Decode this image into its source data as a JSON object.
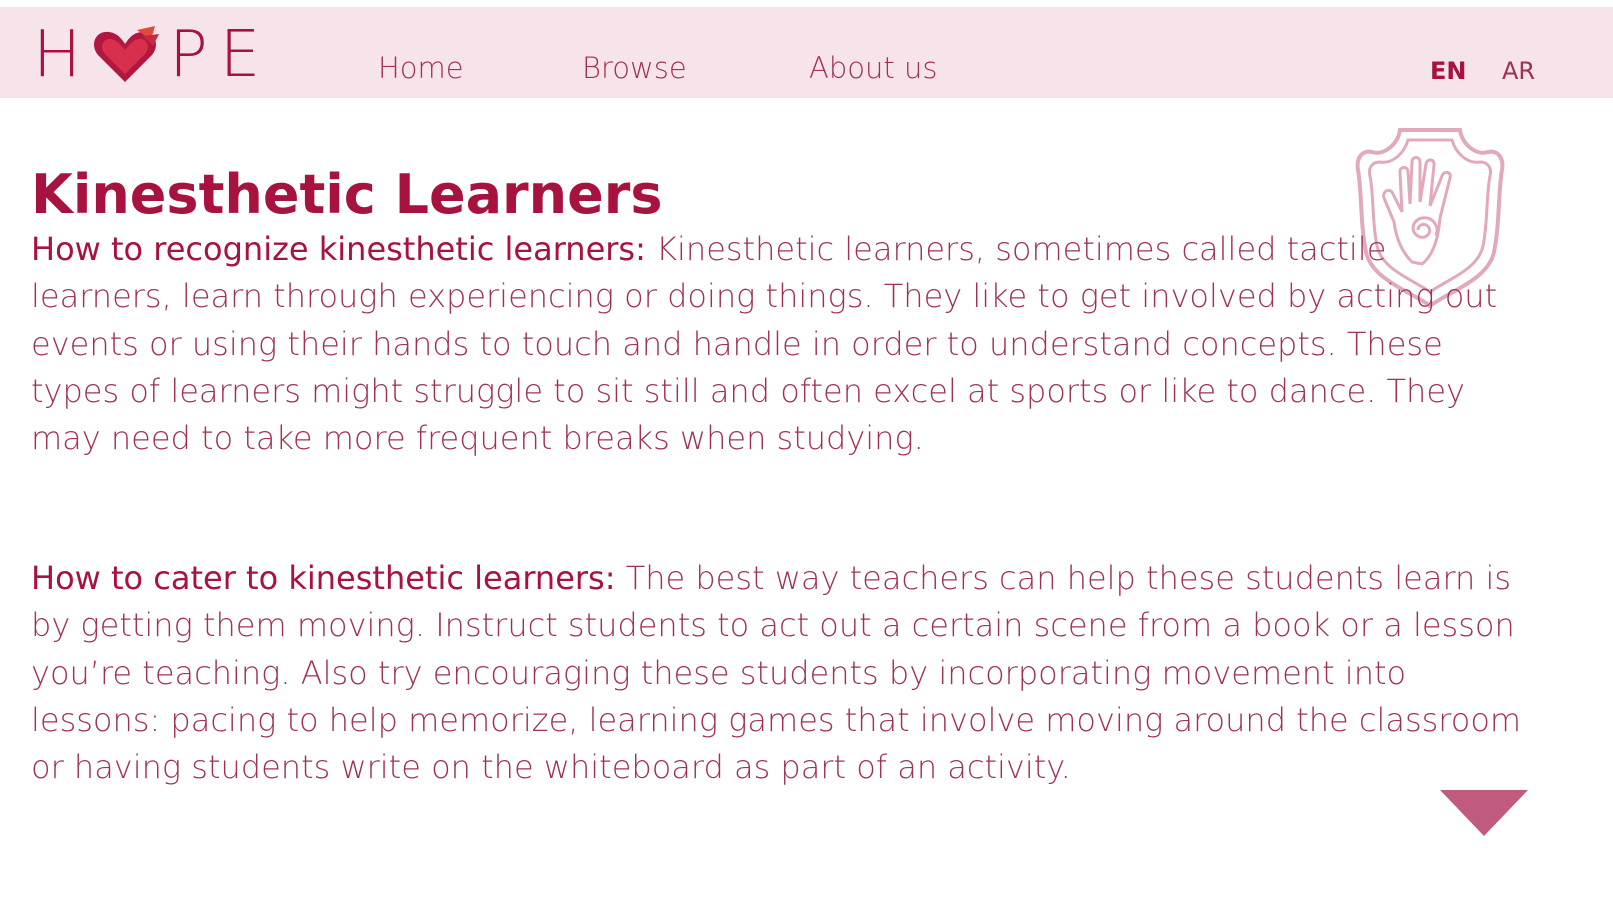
{
  "header": {
    "logo_letters": [
      "H",
      "P",
      "E"
    ],
    "nav": [
      {
        "label": "Home"
      },
      {
        "label": "Browse"
      },
      {
        "label": "About us"
      }
    ],
    "languages": [
      {
        "label": "EN",
        "active": true
      },
      {
        "label": "AR",
        "active": false
      }
    ]
  },
  "main": {
    "title": "Kinesthetic Learners",
    "sections": [
      {
        "lead": "How to recognize kinesthetic learners:",
        "text": "Kinesthetic learners, sometimes called tactile learners, learn through experiencing or doing things. They like to get involved by acting out events or using their hands to touch and handle in order to understand concepts. These types of learners might struggle to sit still and often excel at sports or like to dance. They may need to take more frequent breaks when studying."
      },
      {
        "lead": "How to cater to kinesthetic learners:",
        "text": "The best way teachers can help these students learn is by getting them moving. Instruct students to act out a certain scene from a book or a lesson you’re teaching. Also try encouraging these students by incorporating movement into lessons: pacing to help memorize, learning games that involve moving around the classroom or having students write on the whiteboard as part of an activity."
      }
    ]
  },
  "icons": {
    "logo_heart": "heart-hands-icon",
    "emblem": "hand-spiral-emblem-icon",
    "scroll": "triangle-down-icon"
  },
  "colors": {
    "brand": "#a8123f",
    "text": "#a0324f",
    "nav_bg": "#f7e3ea",
    "emblem": "#e2a9bd",
    "arrow": "#c05a7e"
  }
}
